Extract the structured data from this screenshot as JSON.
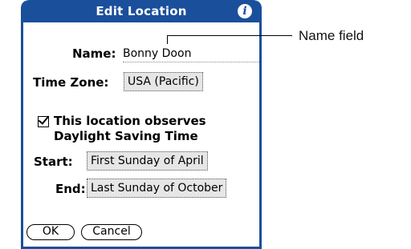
{
  "dialog": {
    "title": "Edit Location",
    "info_icon_glyph": "i",
    "accent_color": "#1a4f9c"
  },
  "form": {
    "name_label": "Name:",
    "name_value": "Bonny Doon",
    "timezone_label": "Time Zone:",
    "timezone_value": "USA (Pacific)",
    "dst_checkbox_checked": true,
    "dst_line1": "This location observes",
    "dst_line2": "Daylight Saving Time",
    "start_label": "Start:",
    "start_value": "First Sunday of April",
    "end_label": "End:",
    "end_value": "Last Sunday of October"
  },
  "buttons": {
    "ok_label": "OK",
    "cancel_label": "Cancel"
  },
  "callout": {
    "label": "Name field"
  }
}
